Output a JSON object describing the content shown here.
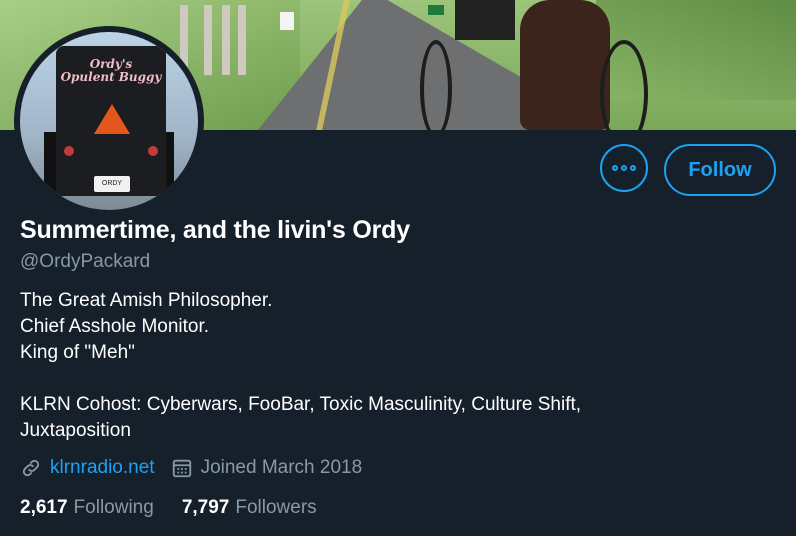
{
  "profile": {
    "display_name": "Summertime, and the livin's Ordy",
    "handle": "@OrdyPackard",
    "bio": "The Great Amish Philosopher.\nChief Asshole Monitor.\nKing of \"Meh\"\n\nKLRN Cohost: Cyberwars, FooBar, Toxic Masculinity, Culture Shift,\nJuxtaposition",
    "website": "klrnradio.net",
    "joined": "Joined March 2018",
    "following_count": "2,617",
    "following_label": "Following",
    "followers_count": "7,797",
    "followers_label": "Followers"
  },
  "avatar": {
    "sign_text": "Ordy's\nOpulent Buggy",
    "plate_text": "ORDY"
  },
  "actions": {
    "more_icon": "more-horizontal-icon",
    "follow_label": "Follow"
  },
  "icons": {
    "link": "link-icon",
    "calendar": "calendar-icon"
  },
  "colors": {
    "background": "#15202b",
    "accent": "#1da1f2",
    "secondary_text": "#8899a6",
    "primary_text": "#ffffff"
  }
}
